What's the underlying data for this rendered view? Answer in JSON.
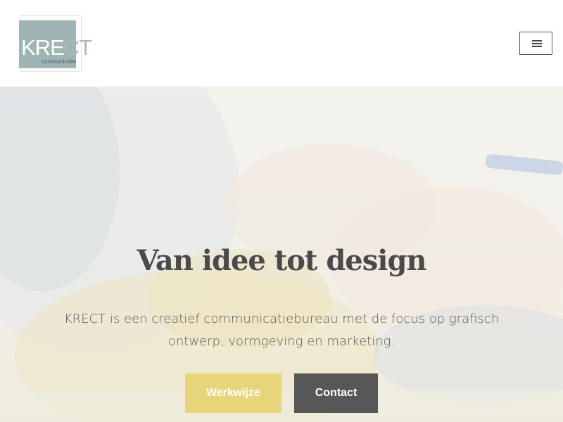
{
  "header": {
    "logo": {
      "word": "KRE",
      "word_tail": "CT",
      "subtitle": "communicatie"
    },
    "menu_icon": "hamburger-icon"
  },
  "hero": {
    "title": "Van idee tot design",
    "text": "KRECT is een creatief communicatiebureau met de focus op grafisch ontwerp, vormgeving en marketing.",
    "buttons": {
      "primary_label": "Werkwijze",
      "secondary_label": "Contact"
    }
  },
  "colors": {
    "logo_teal": "#9fb5b5",
    "accent_yellow": "#e7d57a",
    "button_dark": "#575757",
    "title_text": "#4a4a4a"
  }
}
